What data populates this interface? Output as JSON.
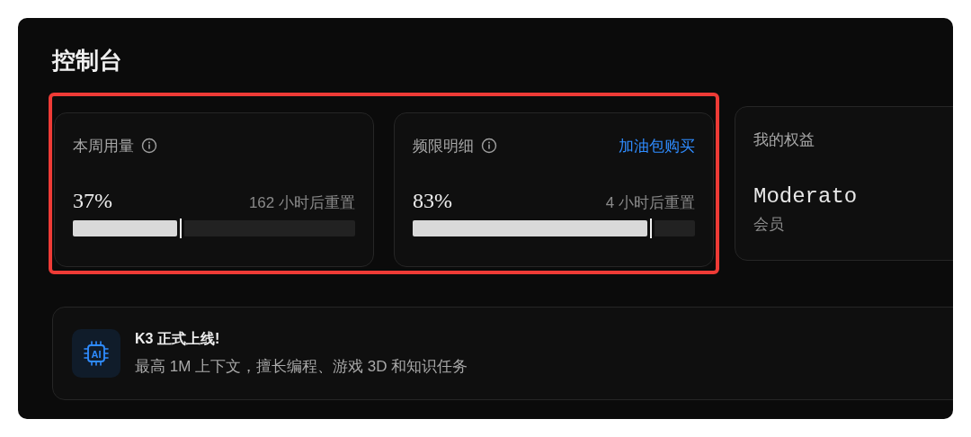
{
  "title": "控制台",
  "cards": [
    {
      "kind": "usage",
      "highlighted": true,
      "label": "本周用量",
      "info": true,
      "percent": "37%",
      "reset": "162 小时后重置",
      "level": 0.37
    },
    {
      "kind": "usage",
      "highlighted": true,
      "label": "频限明细",
      "info": true,
      "link": "加油包购买",
      "percent": "83%",
      "reset": "4 小时后重置",
      "level": 0.83
    },
    {
      "kind": "plan",
      "highlighted": false,
      "label": "我的权益",
      "plan": "Moderato",
      "plan_type": "会员"
    }
  ],
  "banner": {
    "icon_label": "AI",
    "title": "K3 正式上线!",
    "text": "最高 1M 上下文，擅长编程、游戏 3D 和知识任务"
  }
}
